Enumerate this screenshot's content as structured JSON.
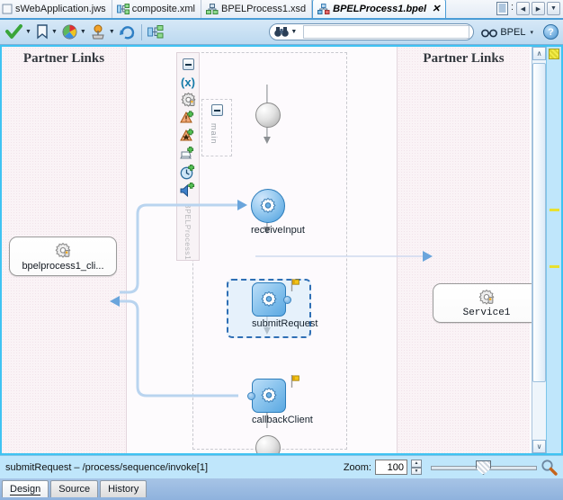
{
  "tabs": [
    {
      "label": "sWebApplication.jws",
      "icon": "jws-icon",
      "active": false,
      "closable": false
    },
    {
      "label": "composite.xml",
      "icon": "composite-icon",
      "active": false,
      "closable": false
    },
    {
      "label": "BPELProcess1.xsd",
      "icon": "xsd-icon",
      "active": false,
      "closable": false
    },
    {
      "label": "BPELProcess1.bpel",
      "icon": "bpel-icon",
      "active": true,
      "closable": true,
      "close_label": "✕"
    }
  ],
  "tab_nav": {
    "list_icon": "document-list-icon",
    "separator": ":",
    "prev_label": "◀",
    "next_label": "▶",
    "dropdown_label": "▼"
  },
  "toolbar": {
    "items": [
      {
        "name": "validate-button",
        "icon": "green-check-icon",
        "has_dropdown": true
      },
      {
        "name": "bookmark-button",
        "icon": "bookmark-icon",
        "has_dropdown": true
      },
      {
        "name": "palette-button",
        "icon": "color-wheel-icon",
        "has_dropdown": true
      },
      {
        "name": "deploy-button",
        "icon": "deploy-icon",
        "has_dropdown": true
      },
      {
        "name": "refresh-button",
        "icon": "refresh-arrows-icon",
        "has_dropdown": false
      },
      {
        "name": "composite-button",
        "icon": "composite-nodes-icon",
        "has_dropdown": false
      }
    ],
    "search": {
      "icon": "binoculars-icon",
      "dropdown_label": "▾",
      "value": "",
      "placeholder": ""
    },
    "view_selector": {
      "icon": "glasses-icon",
      "label": "BPEL",
      "dropdown_label": "▾"
    },
    "help_label": "?"
  },
  "editor": {
    "left_panel": {
      "title": "Partner Links"
    },
    "right_panel": {
      "title": "Partner Links"
    },
    "palette": {
      "collapse_label": "−",
      "vertical_label": "BPELProcess1",
      "items": [
        {
          "name": "palette-collapse-toggle",
          "icon": "collapse-box-icon"
        },
        {
          "name": "palette-variables",
          "icon": "variables-x-icon",
          "label": "(x)"
        },
        {
          "name": "palette-partner-links",
          "icon": "gear-partnerlink-icon"
        },
        {
          "name": "palette-correlation-sets",
          "icon": "warning-add-icon"
        },
        {
          "name": "palette-fault-handlers",
          "icon": "fault-add-icon"
        },
        {
          "name": "palette-event-handlers",
          "icon": "event-add-icon"
        },
        {
          "name": "palette-alarm-handlers",
          "icon": "clock-add-icon"
        },
        {
          "name": "palette-message-handlers",
          "icon": "message-add-icon"
        }
      ]
    },
    "scope": {
      "collapse_label": "−",
      "label": "main"
    },
    "flow": {
      "start_node": {
        "name": "start-terminal",
        "icon": "start-circle-icon"
      },
      "end_node": {
        "name": "end-terminal",
        "icon": "end-circle-icon"
      },
      "activities": [
        {
          "name": "receive-input-activity",
          "label": "receiveInput",
          "shape": "circle",
          "icon": "gear-icon",
          "selected": false,
          "has_flag": false
        },
        {
          "name": "submit-request-activity",
          "label": "submitRequest",
          "shape": "rounded-rect",
          "icon": "gear-icon",
          "selected": true,
          "has_flag": true
        },
        {
          "name": "callback-client-activity",
          "label": "callbackClient",
          "shape": "rounded-rect",
          "icon": "gear-icon",
          "selected": false,
          "has_flag": true
        }
      ]
    },
    "partner_links": [
      {
        "name": "partner-link-client",
        "label": "bpelprocess1_cli...",
        "icon": "gear-partnerlink-icon",
        "side": "left"
      },
      {
        "name": "partner-link-service1",
        "label": "Service1",
        "icon": "gear-partnerlink-icon",
        "side": "right"
      }
    ],
    "scrollbar": {
      "up_label": "∧",
      "down_label": "∨"
    }
  },
  "status": {
    "text": "submitRequest – /process/sequence/invoke[1]",
    "zoom_label": "Zoom:",
    "zoom_value": "100",
    "spinner_up": "▲",
    "spinner_down": "▼",
    "zoom_reset_icon": "magnifier-icon"
  },
  "bottom_tabs": [
    {
      "label": "Design",
      "active": true
    },
    {
      "label": "Source",
      "active": false
    },
    {
      "label": "History",
      "active": false
    }
  ]
}
